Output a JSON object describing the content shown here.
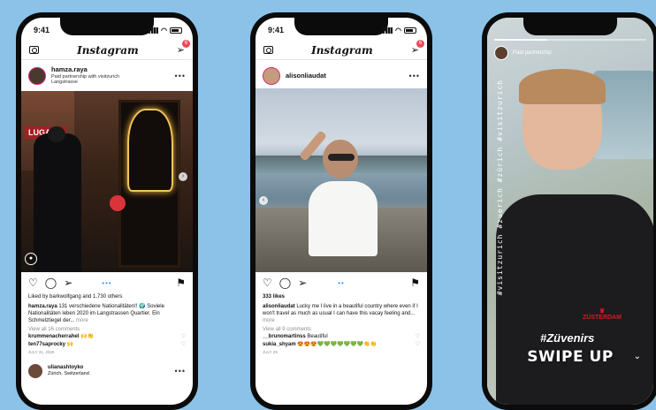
{
  "phone1": {
    "status_time": "9:41",
    "app_title": "Instagram",
    "dm_badge": "6",
    "post": {
      "username": "hamza.raya",
      "partnership": "Paid partnership with visitzurich",
      "location": "Langstrasse",
      "sign_text": "LUGANO",
      "liked_by": "Liked by barkwolfgang and 1,730 others",
      "caption_user": "hamza.raya",
      "caption_text": "131 verschiedene Nationalitäten!! 🌍 Soviele Nationalitäten leben 2020 im Langstrassen Quartier. Ein Schmelztiegel der...",
      "caption_more": "more",
      "view_comments": "View all 16 comments",
      "comment1_user": "krummenacherrahel",
      "comment1_text": "🙌👏",
      "comment2_user": "ten77saprocky",
      "comment2_text": "🙌",
      "date": "JULY 31, 2020",
      "next_user": "ulianashtoyko",
      "next_location": "Zürich, Switzerland"
    }
  },
  "phone2": {
    "status_time": "9:41",
    "app_title": "Instagram",
    "dm_badge": "6",
    "post": {
      "username": "alisonliaudat",
      "likes": "333 likes",
      "caption_user": "alisonliaudat",
      "caption_text": "Lucky me I live in a beautiful country where even if I won't travel as much as usual I can have this vacay feeling and...",
      "caption_more": "more",
      "view_comments": "View all 9 comments",
      "comment1_user": "__brunomartinss",
      "comment1_text": "Beautiful",
      "comment2_user": "sukia_shyam",
      "comment2_text": "😍😍😍💚💚💚💚💚💚💚👏👏",
      "date": "JULY 29"
    }
  },
  "phone3": {
    "story_user": "",
    "story_sub": "Paid partnership",
    "vertical_text": "#visitzurich #zuerich #zürich #visitzurich",
    "shirt_brand": "ZÜSTERDAM",
    "hashtag": "#Züvenirs",
    "swipe_up": "SWIPE UP"
  },
  "colors": {
    "background": "#8cc2e8",
    "link_blue": "#3897f0",
    "notification_red": "#ed4956"
  }
}
